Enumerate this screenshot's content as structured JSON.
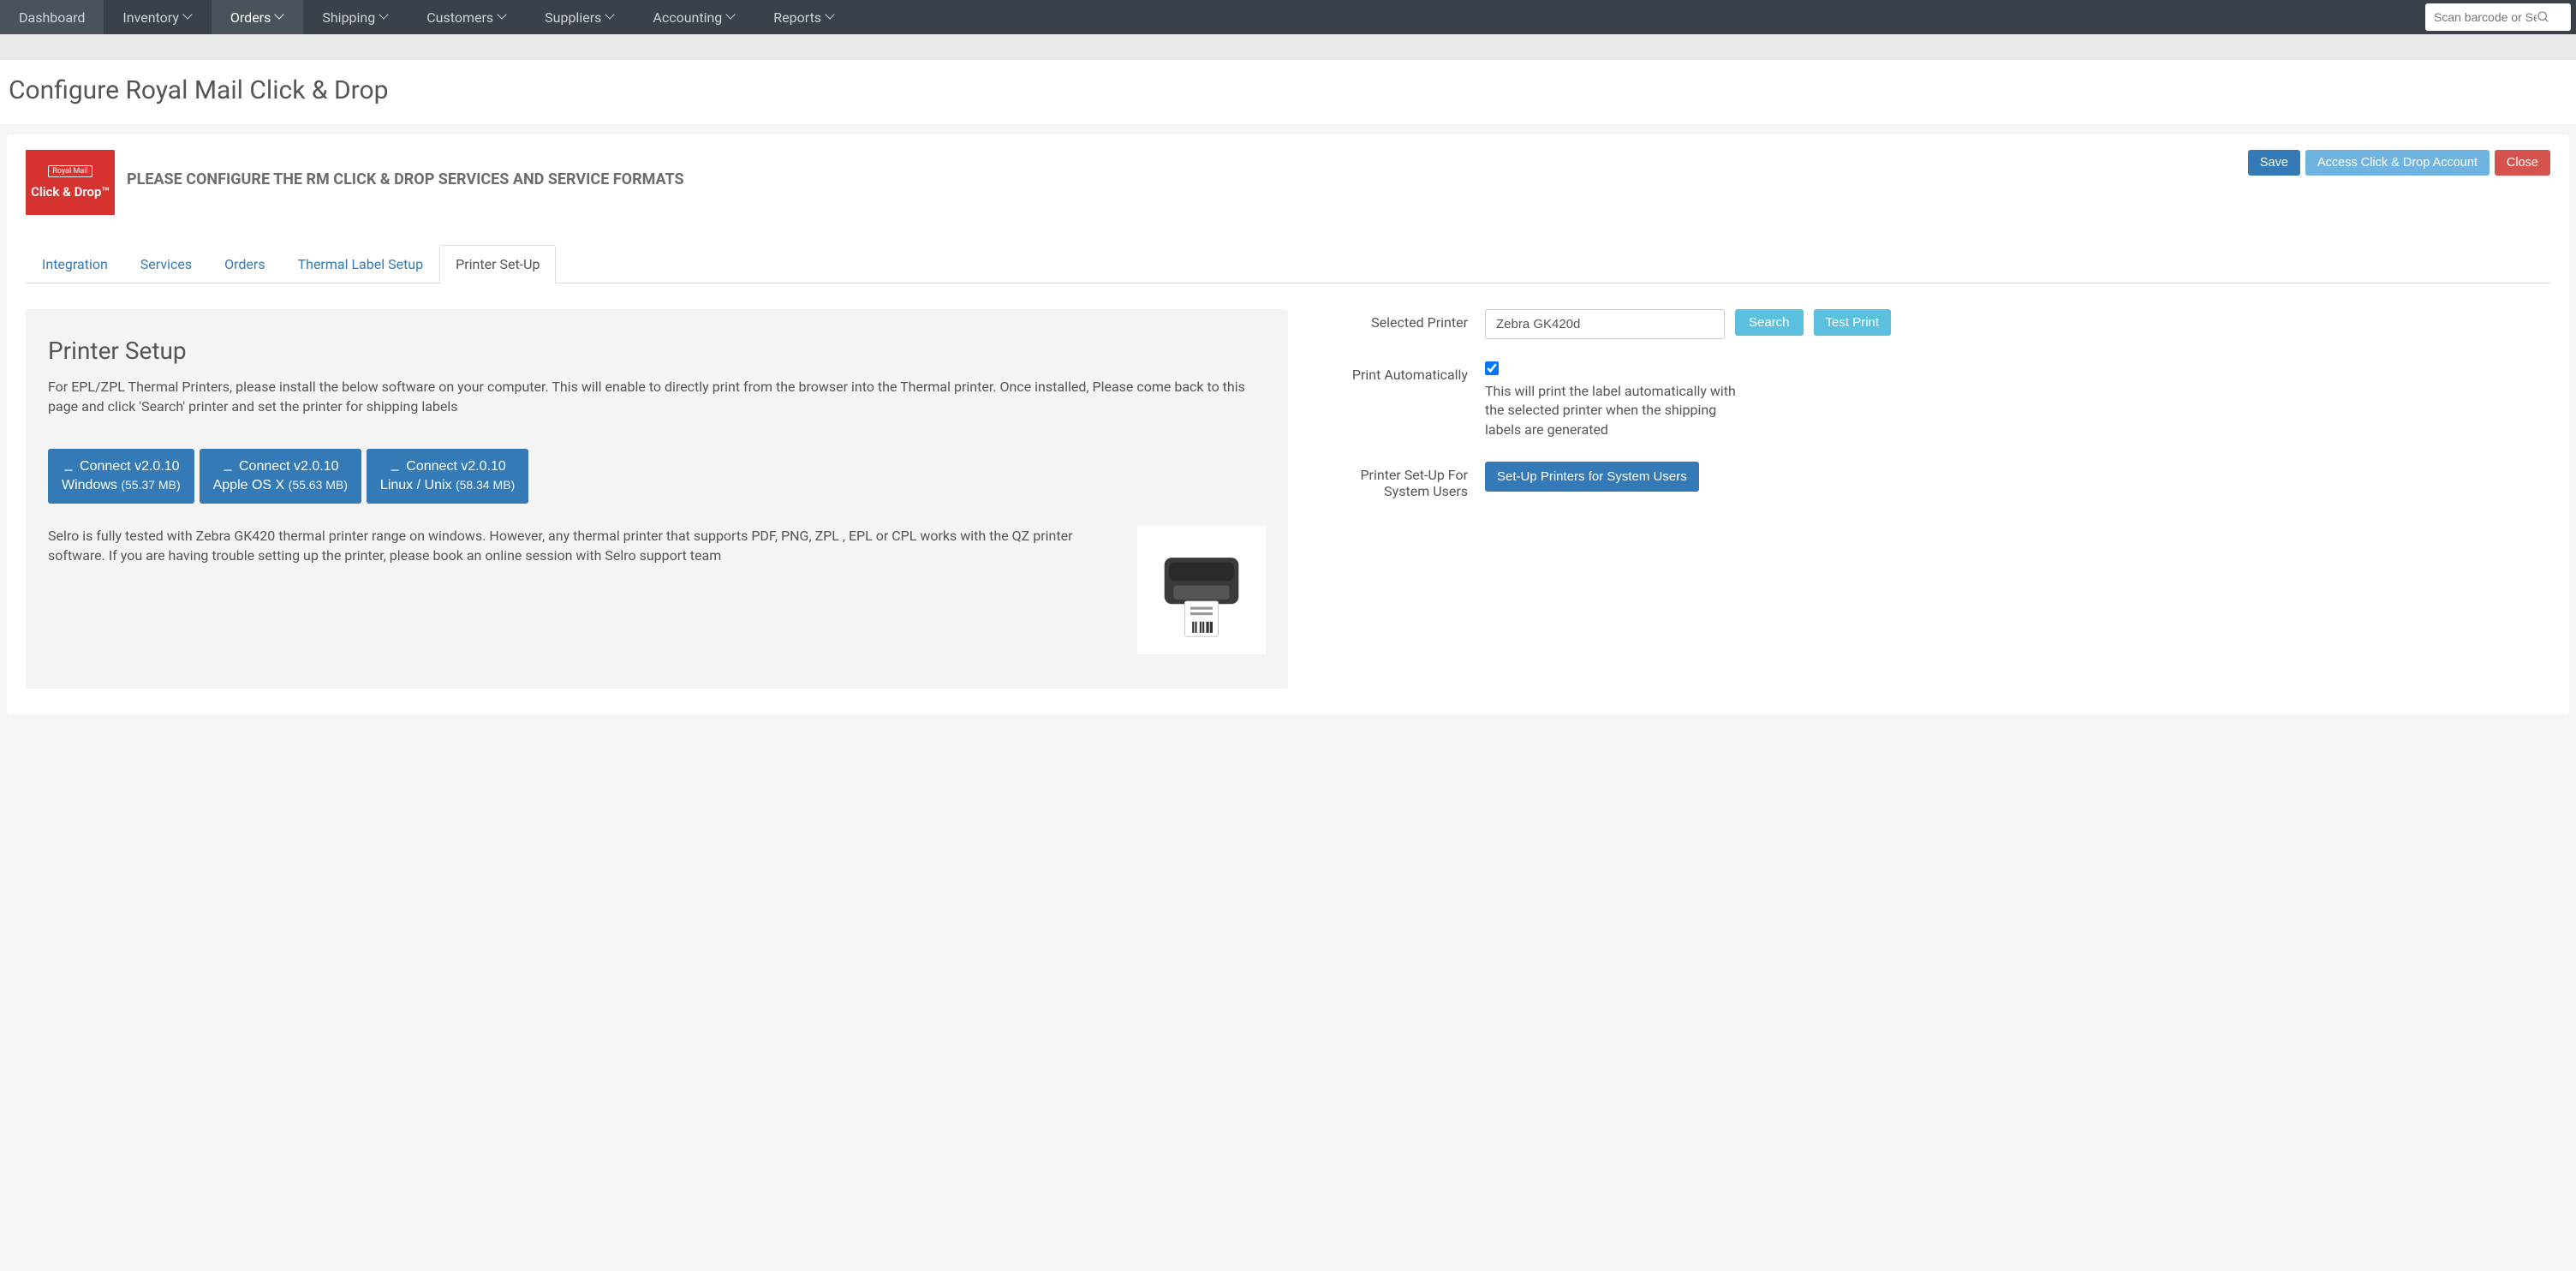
{
  "nav": {
    "items": [
      {
        "label": "Dashboard",
        "dropdown": false
      },
      {
        "label": "Inventory",
        "dropdown": true
      },
      {
        "label": "Orders",
        "dropdown": true,
        "active": true
      },
      {
        "label": "Shipping",
        "dropdown": true
      },
      {
        "label": "Customers",
        "dropdown": true
      },
      {
        "label": "Suppliers",
        "dropdown": true
      },
      {
        "label": "Accounting",
        "dropdown": true
      },
      {
        "label": "Reports",
        "dropdown": true
      }
    ],
    "search_placeholder": "Scan barcode or Search"
  },
  "page": {
    "title": "Configure Royal Mail Click & Drop"
  },
  "header": {
    "logo_top": "Royal Mail",
    "logo_bottom": "Click & Drop™",
    "config_text": "PLEASE CONFIGURE THE RM CLICK & DROP SERVICES AND SERVICE FORMATS",
    "save": "Save",
    "access": "Access Click & Drop Account",
    "close": "Close"
  },
  "tabs": [
    {
      "label": "Integration"
    },
    {
      "label": "Services"
    },
    {
      "label": "Orders"
    },
    {
      "label": "Thermal Label Setup"
    },
    {
      "label": "Printer Set-Up",
      "active": true
    }
  ],
  "setup": {
    "title": "Printer Setup",
    "desc": "For EPL/ZPL Thermal Printers, please install the below software on your computer. This will enable to directly print from the browser into the Thermal printer. Once installed, Please come back to this page and click 'Search' printer and set the printer for shipping labels",
    "downloads": [
      {
        "line1": "Connect v2.0.10",
        "line2": "Windows",
        "size": "(55.37 MB)"
      },
      {
        "line1": "Connect v2.0.10",
        "line2": "Apple OS X",
        "size": "(55.63 MB)"
      },
      {
        "line1": "Connect v2.0.10",
        "line2": "Linux / Unix",
        "size": "(58.34 MB)"
      }
    ],
    "info": "Selro is fully tested with Zebra GK420 thermal printer range on windows. However, any thermal printer that supports PDF, PNG, ZPL , EPL or CPL works with the QZ printer software. If you are having trouble setting up the printer, please book an online session with Selro support team"
  },
  "form": {
    "selected_printer_label": "Selected Printer",
    "selected_printer_value": "Zebra GK420d",
    "search_btn": "Search",
    "test_btn": "Test Print",
    "auto_label": "Print Automatically",
    "auto_checked": true,
    "auto_helper": "This will print the label automatically with the selected printer when the shipping labels are generated",
    "system_label_l1": "Printer Set-Up For",
    "system_label_l2": "System Users",
    "system_btn": "Set-Up Printers for System Users"
  }
}
